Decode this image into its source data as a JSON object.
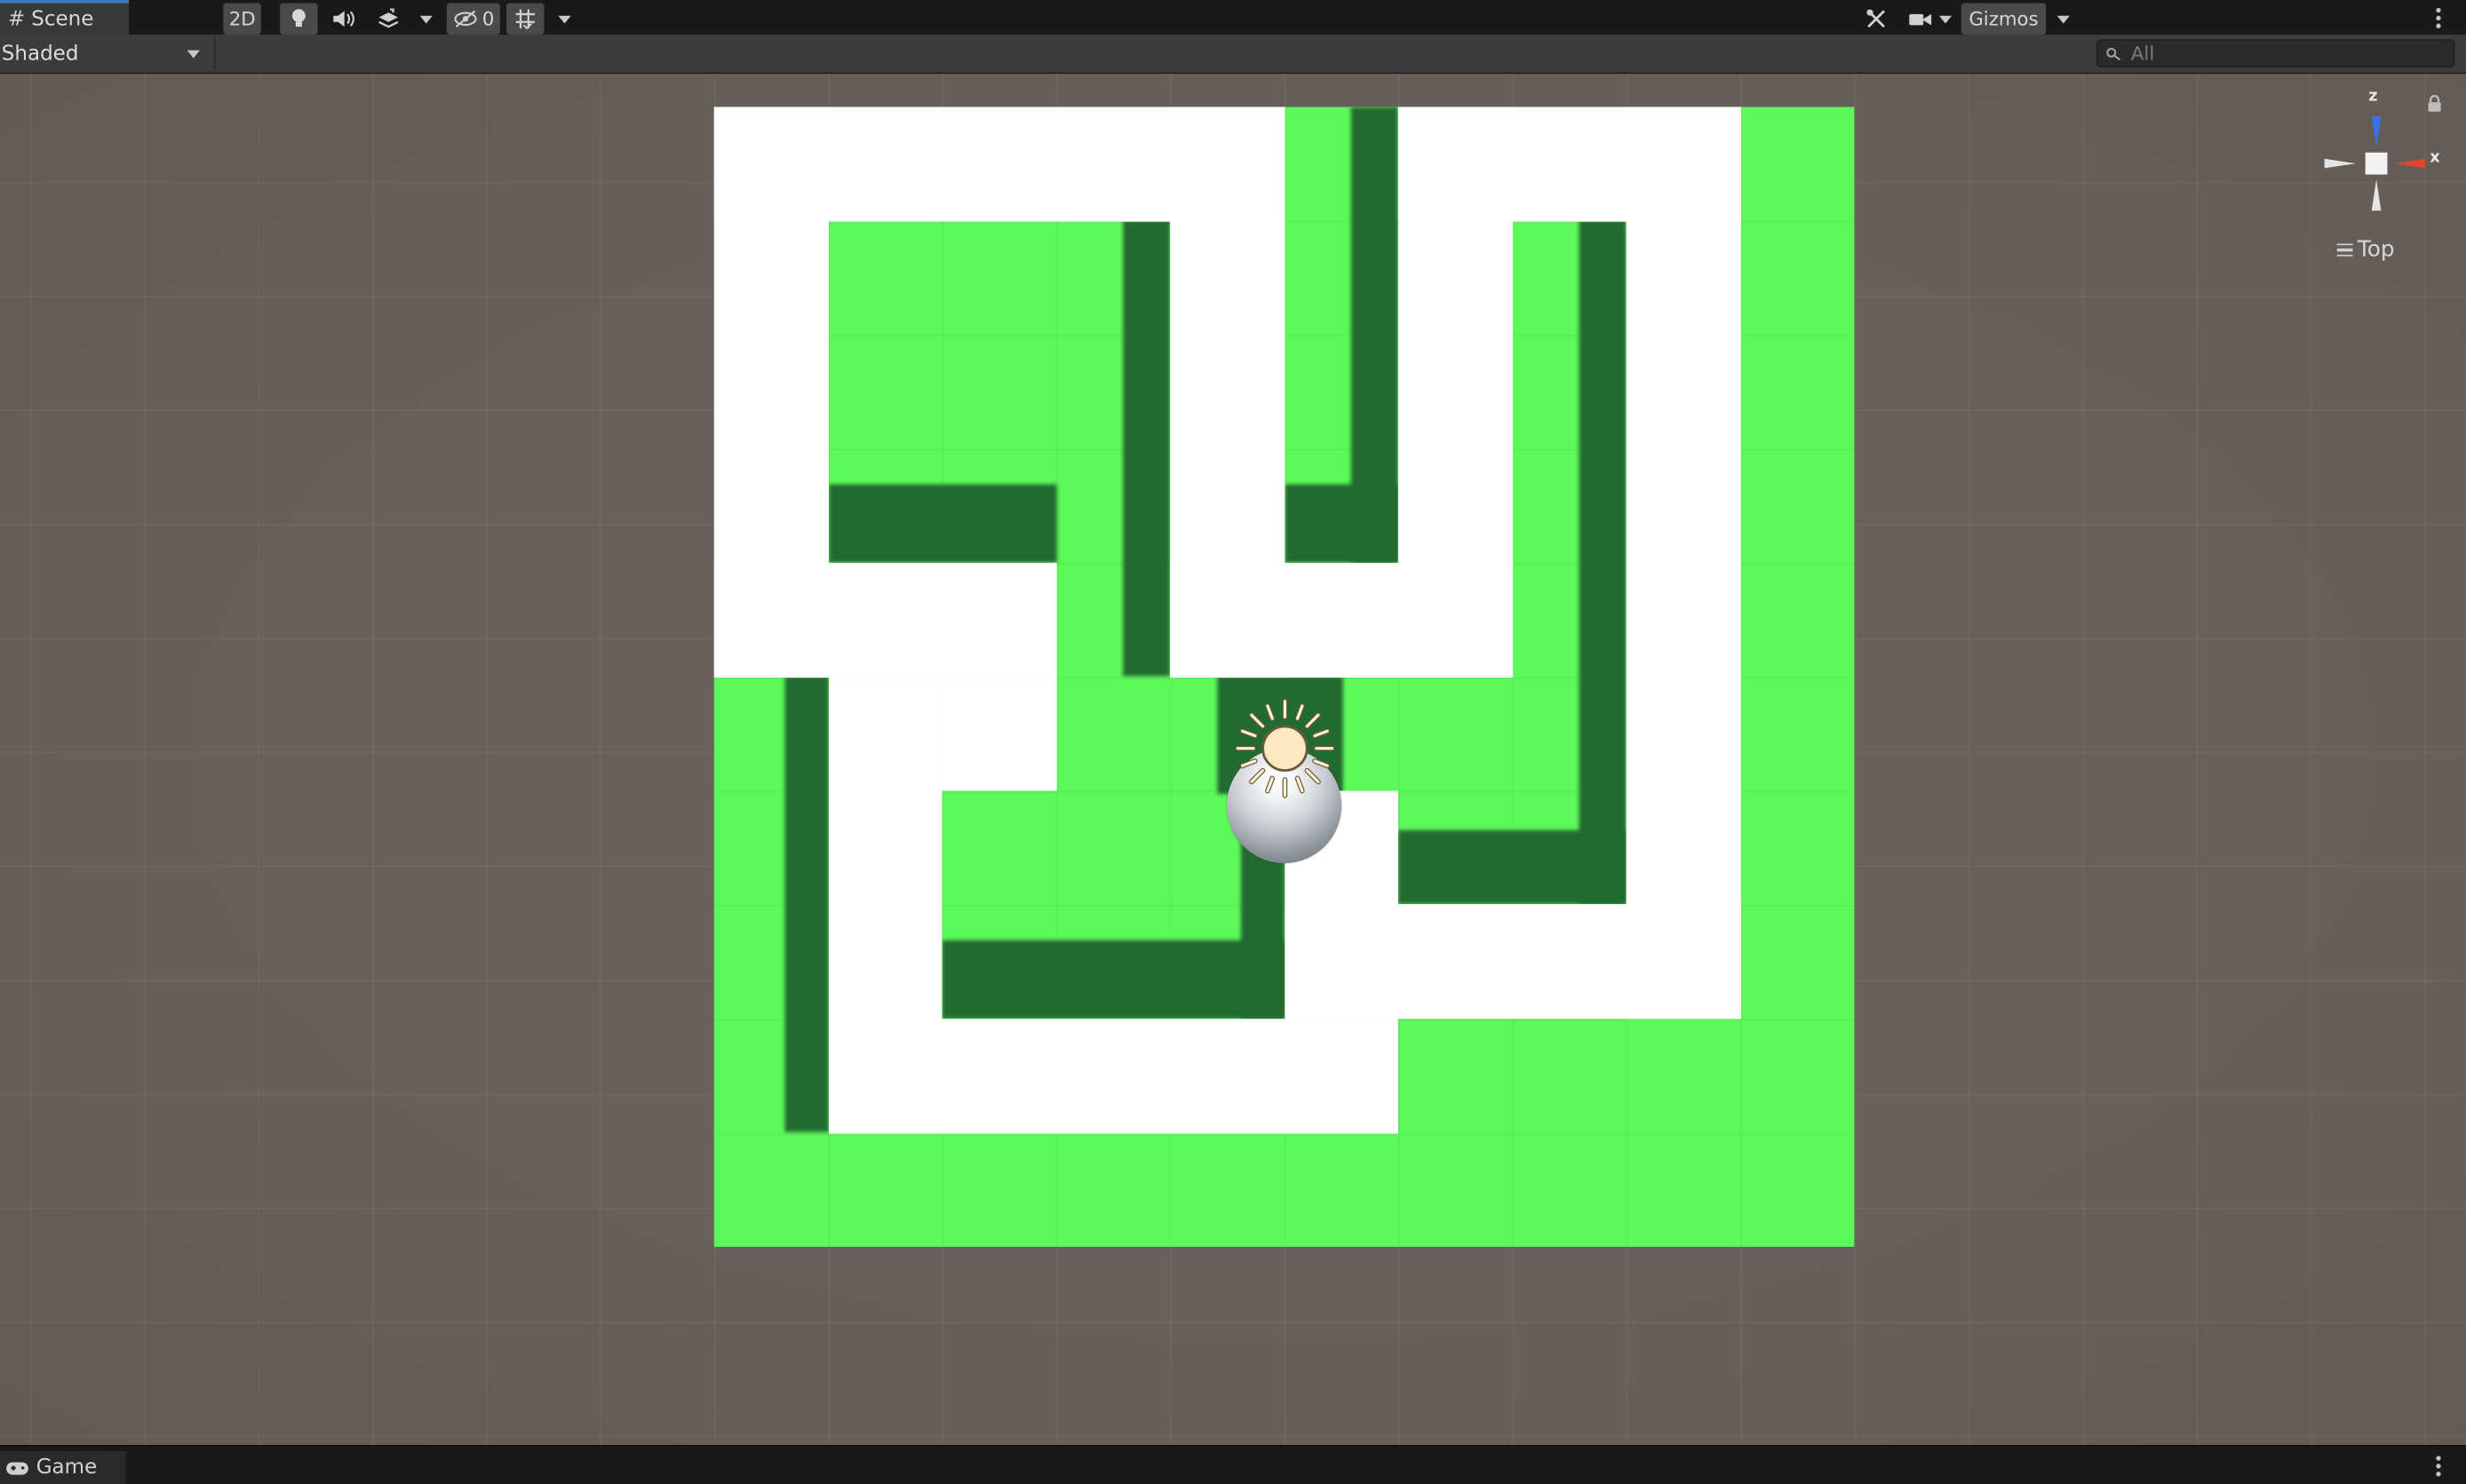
{
  "tabs": {
    "scene_label": "Scene",
    "game_label": "Game"
  },
  "toolbar": {
    "draw_mode": "Shaded",
    "mode_2d": "2D",
    "hidden_count": "0",
    "gizmos_label": "Gizmos",
    "search_placeholder": "All"
  },
  "gizmo": {
    "axis_x": "x",
    "axis_z": "z",
    "view_label": "Top"
  },
  "icons": {
    "scene_tab": "grid-hash-icon",
    "lighting": "lightbulb-icon",
    "audio": "speaker-icon",
    "effects": "layers-icon",
    "visibility": "eye-slash-icon",
    "grid": "grid-toggle-icon",
    "tools": "tools-icon",
    "camera": "camera-icon",
    "search": "search-icon",
    "lock": "lock-icon",
    "game_tab": "gamepad-icon",
    "light_gizmo": "sun-icon"
  },
  "colors": {
    "ground": "#5cf95a",
    "wall": "#ffffff",
    "shadow": "#236a31",
    "background": "#686059",
    "x_axis": "#e0452e",
    "z_axis": "#3a73e8"
  }
}
